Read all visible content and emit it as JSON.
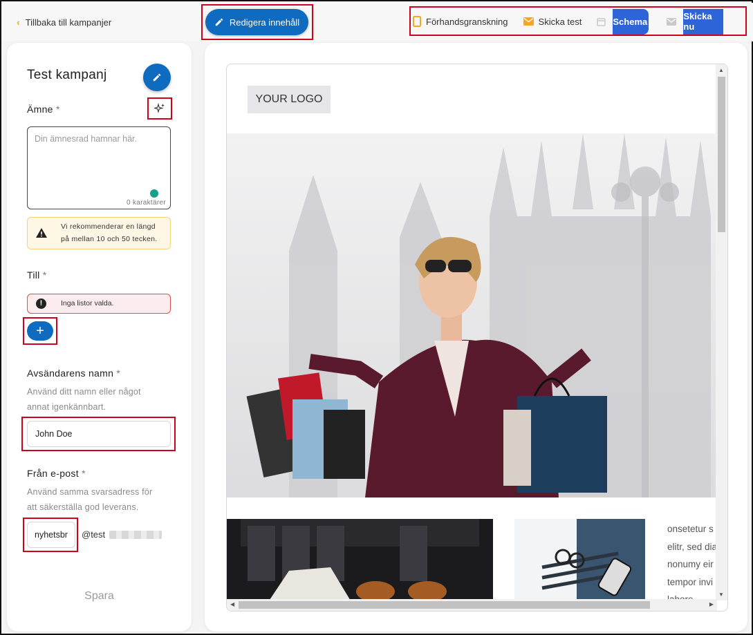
{
  "topbar": {
    "back_label": "Tillbaka till kampanjer",
    "edit_content_label": "Redigera innehåll",
    "preview_label": "Förhandsgranskning",
    "send_test_label": "Skicka test",
    "schedule_label": "Schema",
    "send_now_label": "Skicka nu"
  },
  "campaign": {
    "title": "Test kampanj"
  },
  "subject": {
    "label": "Ämne",
    "required_mark": "*",
    "placeholder": "Din ämnesrad hamnar här.",
    "counter": "0 karaktärer",
    "warning_line1": "Vi rekommenderar en längd",
    "warning_line2": "på mellan 10 och 50 tecken."
  },
  "to": {
    "label": "Till",
    "required_mark": "*",
    "error": "Inga listor valda.",
    "add_symbol": "+"
  },
  "sender": {
    "label": "Avsändarens namn",
    "required_mark": "*",
    "help_line1": "Använd ditt namn eller något",
    "help_line2": "annat igenkännbart.",
    "value": "John Doe"
  },
  "from_email": {
    "label": "Från e-post",
    "required_mark": "*",
    "help_line1": "Använd samma svarsadress för",
    "help_line2": "att säkerställa god leverans.",
    "value": "nyhetsbr",
    "domain": "@test"
  },
  "save_label": "Spara",
  "email_preview": {
    "logo_text": "YOUR LOGO",
    "side_lines": [
      "onsetetur s",
      "elitr, sed dia",
      "nonumy eir",
      "tempor invi",
      "labore"
    ]
  },
  "colors": {
    "primary": "#0e6bbf",
    "accent_orange": "#f5a623",
    "highlight_red": "#d0021b",
    "action_blue": "#2d64d8"
  }
}
